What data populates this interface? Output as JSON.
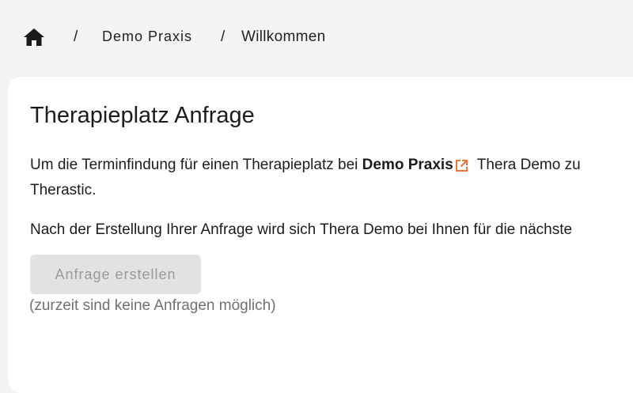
{
  "breadcrumb": {
    "home_icon": "home-icon",
    "separator": "/",
    "practice": "Demo Praxis",
    "current": "Willkommen"
  },
  "main": {
    "title": "Therapieplatz Anfrage",
    "intro_before": "Um die Terminfindung für einen Therapieplatz bei ",
    "intro_practice": "Demo Praxis",
    "intro_after": " Thera Demo zu",
    "intro_line2": "Therastic.",
    "followup": "Nach der Erstellung Ihrer Anfrage wird sich Thera Demo bei Ihnen für die nächste",
    "button_label": "Anfrage erstellen",
    "note": "(zurzeit sind keine Anfragen möglich)"
  },
  "colors": {
    "link_icon": "#e8753a",
    "button_bg": "#e2e2e2",
    "button_text": "#9a9a9a",
    "note_text": "#707070"
  }
}
